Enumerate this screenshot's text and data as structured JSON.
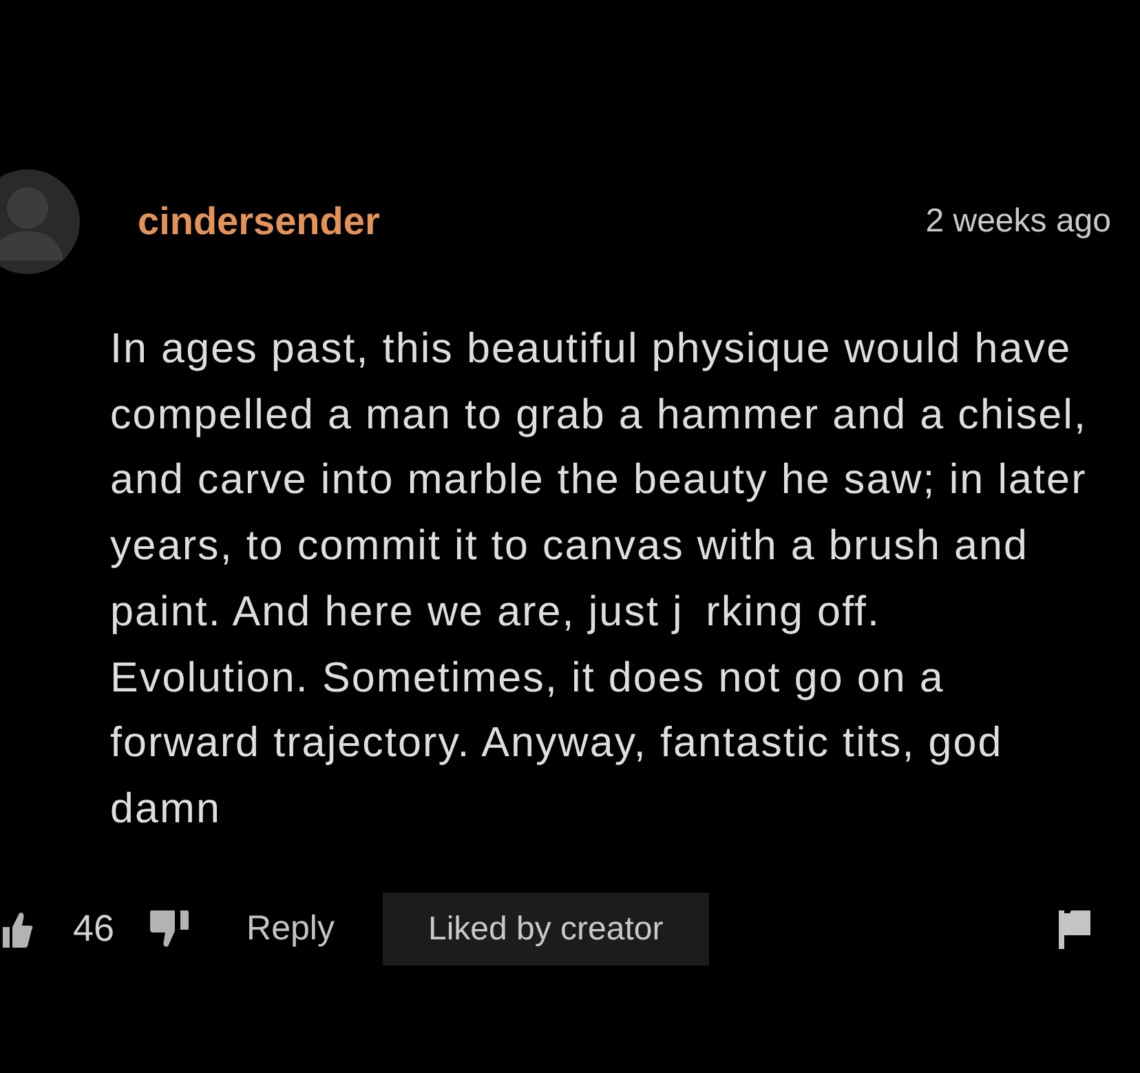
{
  "comment": {
    "author": "cindersender",
    "time": "2 weeks ago",
    "body": "In ages past, this beautiful physique would have compelled a man to grab a hammer and a chisel, and carve into marble the beauty he saw; in later years, to commit it to canvas with a brush and paint. And here we are, just j rking off. Evolution. Sometimes, it does not go on a forward trajectory. Anyway, fantastic tits, god damn",
    "likes": "46",
    "reply": "Reply",
    "badge": "Liked by creator"
  }
}
